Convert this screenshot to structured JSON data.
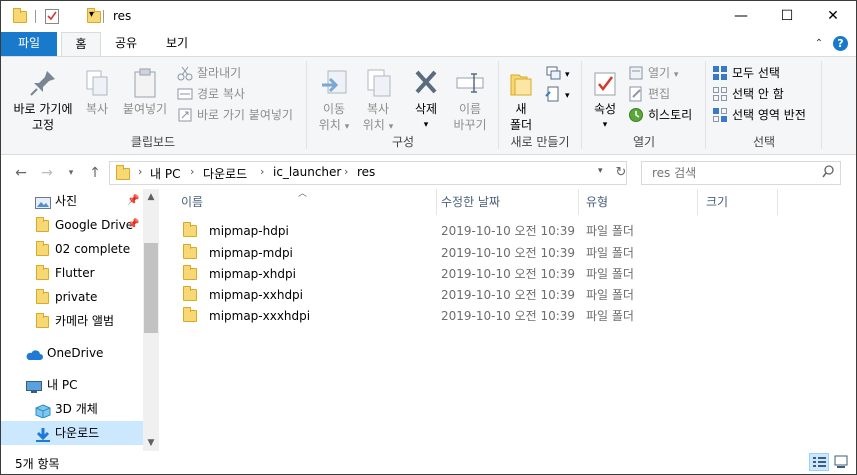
{
  "window": {
    "title": "res",
    "controls": {
      "minimize": "—",
      "maximize": "☐",
      "close": "✕"
    }
  },
  "ribbon_tabs": [
    {
      "label": "파일"
    },
    {
      "label": "홈"
    },
    {
      "label": "공유"
    },
    {
      "label": "보기"
    }
  ],
  "ribbon": {
    "clipboard": {
      "label": "클립보드",
      "pin": "바로 가기에\n고정",
      "pin_l1": "바로 가기에",
      "pin_l2": "고정",
      "copy": "복사",
      "paste": "붙여넣기",
      "cut": "잘라내기",
      "copy_path": "경로 복사",
      "paste_shortcut": "바로 가기 붙여넣기"
    },
    "organize": {
      "label": "구성",
      "move_l1": "이동",
      "move_l2": "위치",
      "copyto_l1": "복사",
      "copyto_l2": "위치",
      "delete": "삭제",
      "rename_l1": "이름",
      "rename_l2": "바꾸기"
    },
    "new": {
      "label": "새로 만들기",
      "folder_l1": "새",
      "folder_l2": "폴더"
    },
    "open": {
      "label": "열기",
      "properties": "속성",
      "open": "열기",
      "edit": "편집",
      "history": "히스토리"
    },
    "select": {
      "label": "선택",
      "all": "모두 선택",
      "none": "선택 안 함",
      "invert": "선택 영역 반전"
    }
  },
  "address": {
    "crumbs": [
      "내 PC",
      "다운로드",
      "ic_launcher",
      "res"
    ],
    "search_placeholder": "res 검색"
  },
  "nav_pane": [
    {
      "label": "사진",
      "icon": "pictures-icon",
      "pinned": true
    },
    {
      "label": "Google Drive",
      "icon": "folder-icon",
      "pinned": true
    },
    {
      "label": "02 complete",
      "icon": "folder-icon"
    },
    {
      "label": "Flutter",
      "icon": "folder-icon"
    },
    {
      "label": "private",
      "icon": "folder-icon"
    },
    {
      "label": "카메라 앨범",
      "icon": "folder-icon"
    },
    {
      "label": "OneDrive",
      "icon": "cloud-icon"
    },
    {
      "label": "내 PC",
      "icon": "pc-icon"
    },
    {
      "label": "3D 개체",
      "icon": "cube-icon"
    },
    {
      "label": "다운로드",
      "icon": "download-icon",
      "selected": true
    }
  ],
  "columns": {
    "name": "이름",
    "modified": "수정한 날짜",
    "type": "유형",
    "size": "크기"
  },
  "files": [
    {
      "name": "mipmap-hdpi",
      "modified": "2019-10-10 오전 10:39",
      "type": "파일 폴더"
    },
    {
      "name": "mipmap-mdpi",
      "modified": "2019-10-10 오전 10:39",
      "type": "파일 폴더"
    },
    {
      "name": "mipmap-xhdpi",
      "modified": "2019-10-10 오전 10:39",
      "type": "파일 폴더"
    },
    {
      "name": "mipmap-xxhdpi",
      "modified": "2019-10-10 오전 10:39",
      "type": "파일 폴더"
    },
    {
      "name": "mipmap-xxxhdpi",
      "modified": "2019-10-10 오전 10:39",
      "type": "파일 폴더"
    }
  ],
  "status": {
    "count": "5개 항목"
  },
  "colors": {
    "accent": "#1979ca",
    "selection": "#cce8ff",
    "folder": "#f8d775"
  }
}
